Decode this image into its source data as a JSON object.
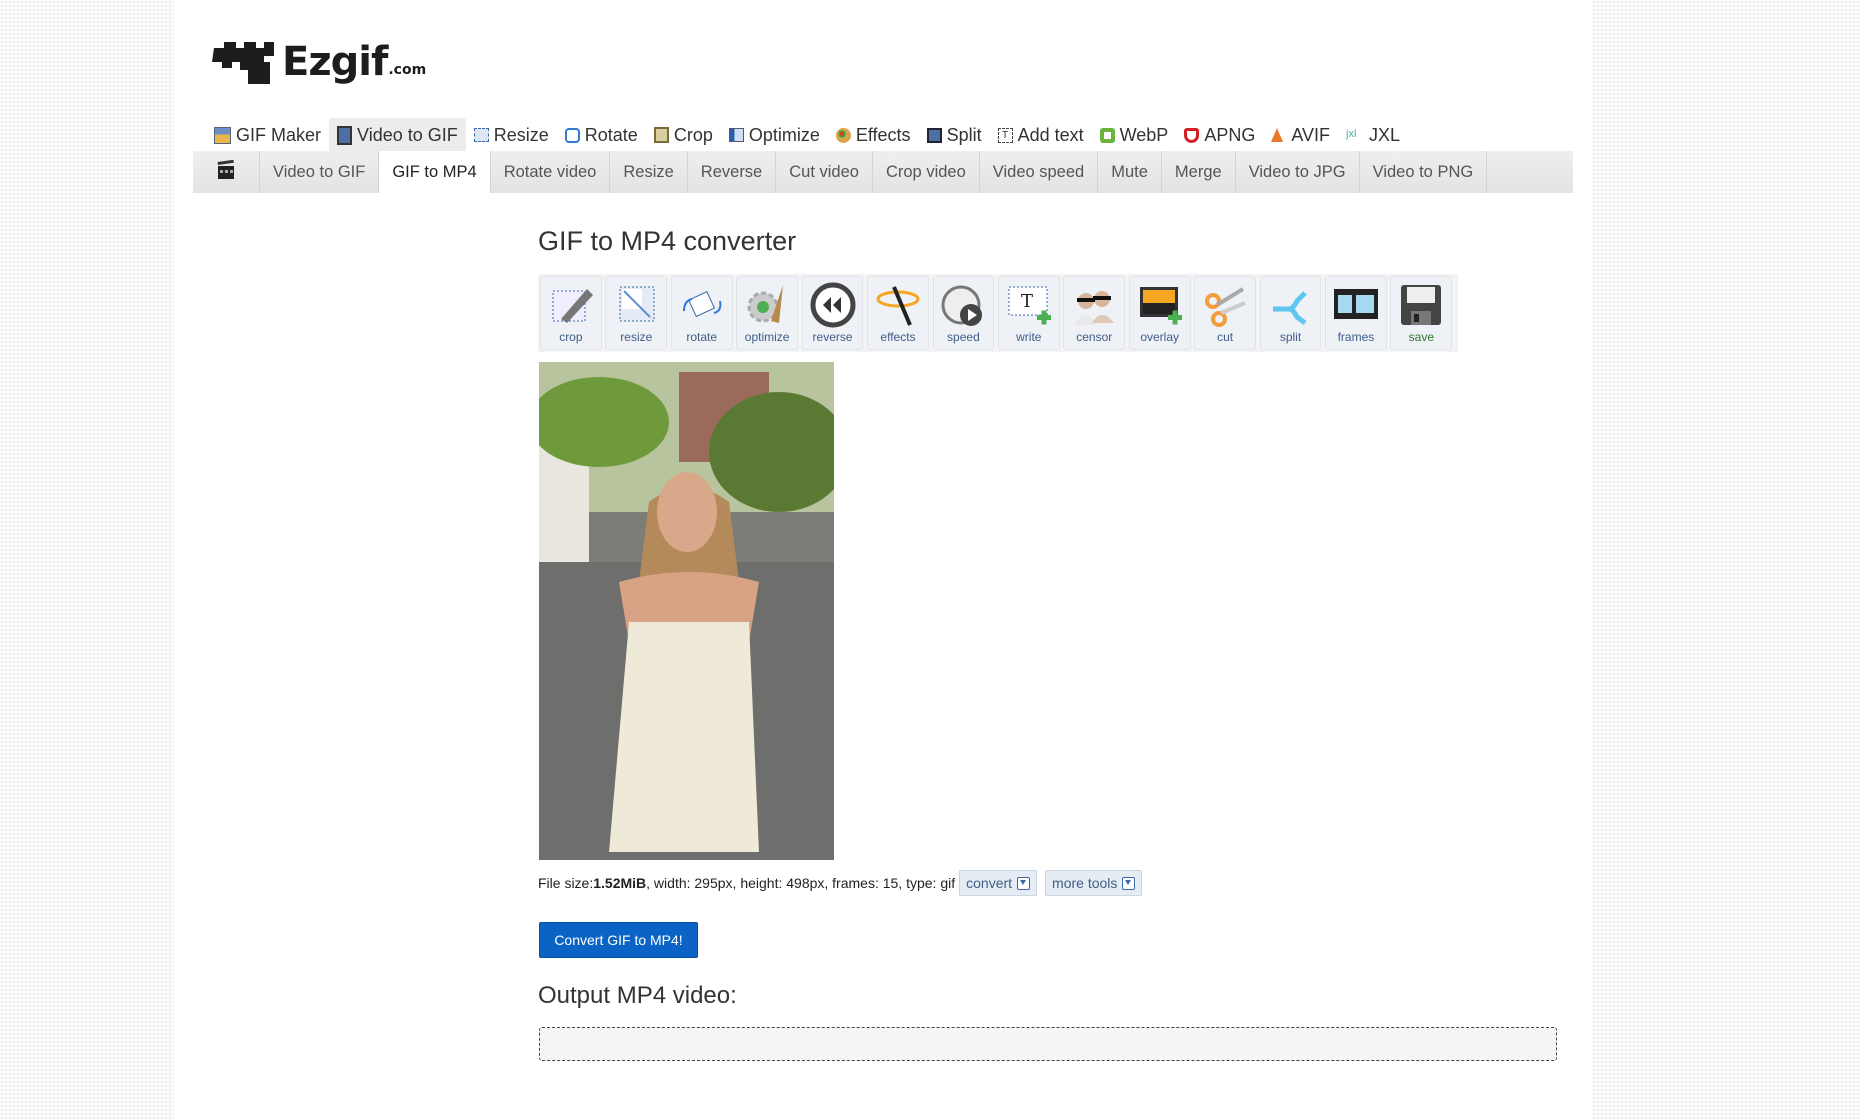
{
  "logo": {
    "name": "Ezgif",
    "suffix": ".com"
  },
  "main_nav": {
    "items": [
      {
        "label": "GIF Maker",
        "icon": "gif-maker-icon",
        "active": false
      },
      {
        "label": "Video to GIF",
        "icon": "film-icon",
        "active": true
      },
      {
        "label": "Resize",
        "icon": "resize-icon",
        "active": false
      },
      {
        "label": "Rotate",
        "icon": "rotate-icon",
        "active": false
      },
      {
        "label": "Crop",
        "icon": "crop-icon",
        "active": false
      },
      {
        "label": "Optimize",
        "icon": "optimize-icon",
        "active": false
      },
      {
        "label": "Effects",
        "icon": "palette-icon",
        "active": false
      },
      {
        "label": "Split",
        "icon": "split-icon",
        "active": false
      },
      {
        "label": "Add text",
        "icon": "add-text-icon",
        "active": false
      },
      {
        "label": "WebP",
        "icon": "webp-icon",
        "active": false
      },
      {
        "label": "APNG",
        "icon": "apng-icon",
        "active": false
      },
      {
        "label": "AVIF",
        "icon": "avif-icon",
        "active": false
      },
      {
        "label": "JXL",
        "icon": "jxl-icon",
        "active": false
      }
    ]
  },
  "sub_nav": {
    "icon": "clapperboard-icon",
    "items": [
      {
        "label": "Video to GIF",
        "active": false
      },
      {
        "label": "GIF to MP4",
        "active": true
      },
      {
        "label": "Rotate video",
        "active": false
      },
      {
        "label": "Resize",
        "active": false
      },
      {
        "label": "Reverse",
        "active": false
      },
      {
        "label": "Cut video",
        "active": false
      },
      {
        "label": "Crop video",
        "active": false
      },
      {
        "label": "Video speed",
        "active": false
      },
      {
        "label": "Mute",
        "active": false
      },
      {
        "label": "Merge",
        "active": false
      },
      {
        "label": "Video to JPG",
        "active": false
      },
      {
        "label": "Video to PNG",
        "active": false
      }
    ]
  },
  "page_title": "GIF to MP4 converter",
  "toolbar": {
    "tools": [
      {
        "label": "crop",
        "icon": "crop-tool-icon"
      },
      {
        "label": "resize",
        "icon": "resize-tool-icon"
      },
      {
        "label": "rotate",
        "icon": "rotate-tool-icon"
      },
      {
        "label": "optimize",
        "icon": "optimize-tool-icon"
      },
      {
        "label": "reverse",
        "icon": "reverse-tool-icon"
      },
      {
        "label": "effects",
        "icon": "effects-tool-icon"
      },
      {
        "label": "speed",
        "icon": "speed-tool-icon"
      },
      {
        "label": "write",
        "icon": "write-tool-icon"
      },
      {
        "label": "censor",
        "icon": "censor-tool-icon"
      },
      {
        "label": "overlay",
        "icon": "overlay-tool-icon"
      },
      {
        "label": "cut",
        "icon": "scissors-tool-icon"
      },
      {
        "label": "split",
        "icon": "split-tool-icon"
      },
      {
        "label": "frames",
        "icon": "frames-tool-icon"
      },
      {
        "label": "save",
        "icon": "floppy-disk-icon"
      }
    ]
  },
  "preview": {
    "alt": "Uploaded GIF preview: woman in floral dress on a city street"
  },
  "file_info": {
    "size_label": "File size: ",
    "size_value": "1.52MiB",
    "rest": ", width: 295px, height: 498px, frames: 15, type: gif",
    "convert_label": "convert",
    "more_tools_label": "more tools"
  },
  "convert_button": "Convert GIF to MP4!",
  "output_heading": "Output MP4 video:",
  "colors": {
    "primary_button": "#0b63c6",
    "tool_label": "#3f5d88",
    "save_label": "#2f7a2f"
  }
}
